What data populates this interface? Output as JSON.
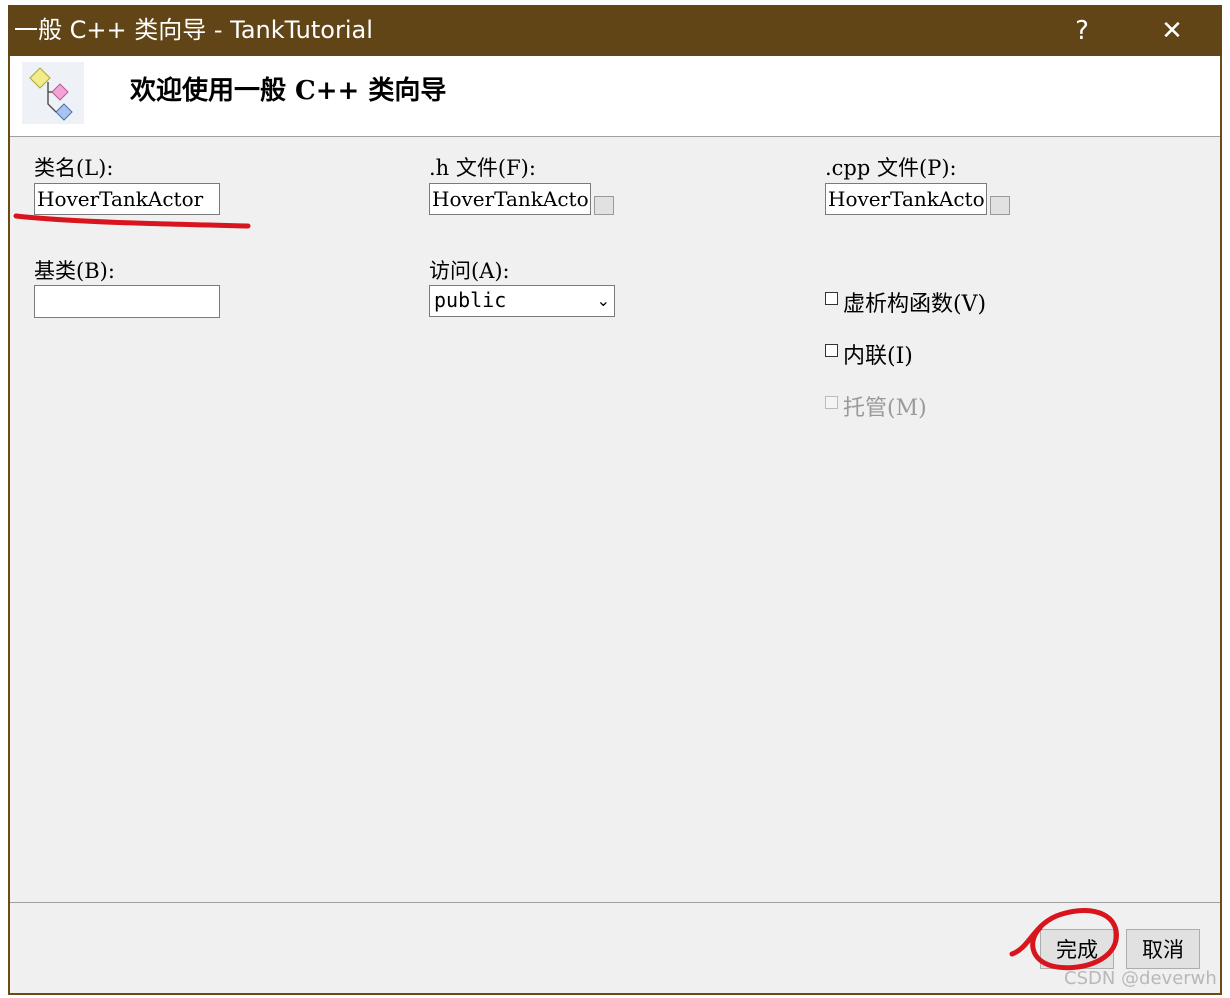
{
  "window": {
    "title": "一般 C++ 类向导 - TankTutorial",
    "help_glyph": "?",
    "close_glyph": "✕"
  },
  "banner": {
    "heading": "欢迎使用一般 C++ 类向导"
  },
  "class_name": {
    "label": "类名(L):",
    "value": "HoverTankActor"
  },
  "h_file": {
    "label": ".h 文件(F):",
    "value": "HoverTankActo"
  },
  "cpp_file": {
    "label": ".cpp 文件(P):",
    "value": "HoverTankActo"
  },
  "base_class": {
    "label": "基类(B):",
    "value": ""
  },
  "access": {
    "label": "访问(A):",
    "selected": "public"
  },
  "options": {
    "virtual_destructor": {
      "label": "虚析构函数(V)",
      "checked": false
    },
    "inline": {
      "label": "内联(I)",
      "checked": false
    },
    "managed": {
      "label": "托管(M)",
      "checked": false,
      "enabled": false
    }
  },
  "buttons": {
    "finish": "完成",
    "cancel": "取消"
  },
  "watermark": "CSDN @deverwh",
  "colors": {
    "titlebar": "#614516",
    "dialog_bg": "#f0f0f0",
    "annotation_red": "#d8141c"
  }
}
